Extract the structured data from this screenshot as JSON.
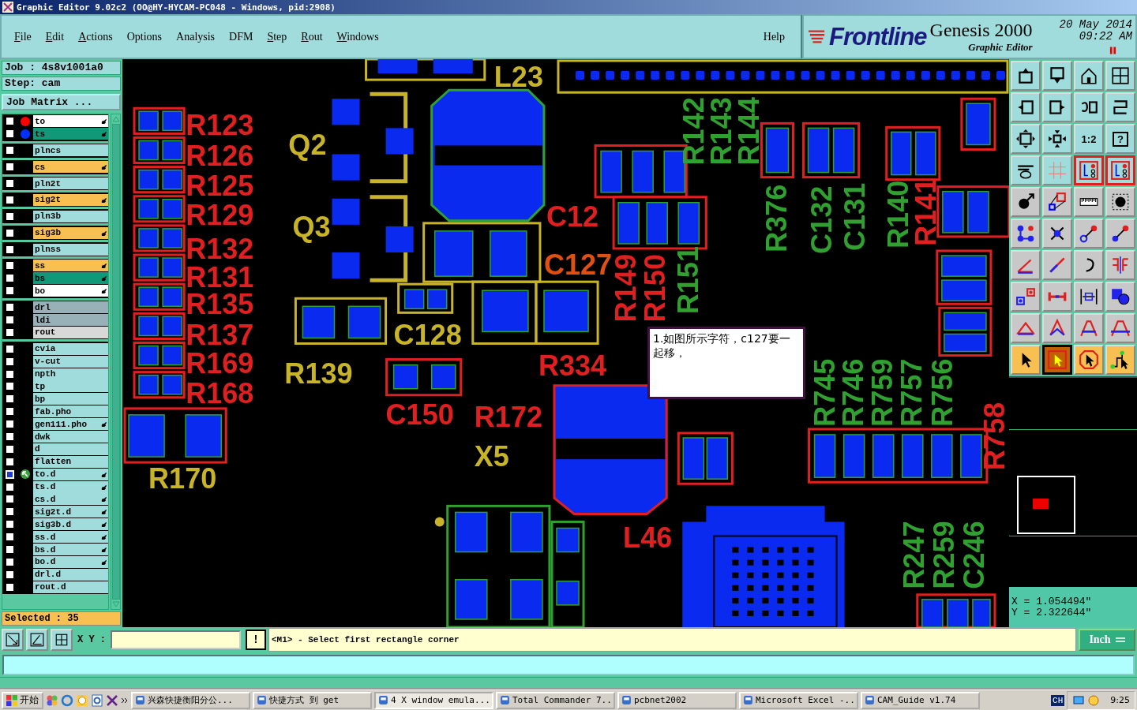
{
  "window": {
    "title": "Graphic Editor 9.02c2 (OO@HY-HYCAM-PC048 - Windows, pid:2908)"
  },
  "menu": [
    {
      "label": "File",
      "mnemonic": true
    },
    {
      "label": "Edit",
      "mnemonic": true
    },
    {
      "label": "Actions",
      "mnemonic": true
    },
    {
      "label": "Options",
      "mnemonic": false
    },
    {
      "label": "Analysis",
      "mnemonic": false
    },
    {
      "label": "DFM",
      "mnemonic": false
    },
    {
      "label": "Step",
      "mnemonic": true
    },
    {
      "label": "Rout",
      "mnemonic": true
    },
    {
      "label": "Windows",
      "mnemonic": true
    }
  ],
  "help": "Help",
  "logo": {
    "brand": "Frontline",
    "product": "Genesis 2000",
    "subtitle": "Graphic Editor",
    "date": "20 May 2014",
    "time": "09:22 AM"
  },
  "job": {
    "job": "Job : 4s8v1001a0",
    "step": "Step: cam",
    "matrix_button": "Job Matrix ..."
  },
  "layer_groups": [
    [
      {
        "name": "to",
        "kind": "white",
        "color": "#ff0000",
        "affected": true,
        "selected": false,
        "work": false
      },
      {
        "name": "ts",
        "kind": "teal",
        "color": "#0030ff",
        "affected": true,
        "selected": false,
        "work": false
      }
    ],
    [
      {
        "name": "plncs",
        "kind": "plain",
        "affected": false,
        "selected": false,
        "work": false
      }
    ],
    [
      {
        "name": "cs",
        "kind": "orange",
        "affected": true,
        "selected": false,
        "work": false
      }
    ],
    [
      {
        "name": "pln2t",
        "kind": "plain",
        "affected": false,
        "selected": false,
        "work": false
      }
    ],
    [
      {
        "name": "sig2t",
        "kind": "orange",
        "affected": true,
        "selected": false,
        "work": false
      }
    ],
    [
      {
        "name": "pln3b",
        "kind": "plain",
        "affected": false,
        "selected": false,
        "work": false
      }
    ],
    [
      {
        "name": "sig3b",
        "kind": "orange",
        "affected": true,
        "selected": false,
        "work": false
      }
    ],
    [
      {
        "name": "plnss",
        "kind": "plain",
        "affected": false,
        "selected": false,
        "work": false
      }
    ],
    [
      {
        "name": "ss",
        "kind": "orange",
        "affected": true,
        "selected": false,
        "work": false
      },
      {
        "name": "bs",
        "kind": "teal",
        "affected": true,
        "selected": false,
        "work": false
      },
      {
        "name": "bo",
        "kind": "white",
        "affected": true,
        "selected": false,
        "work": false
      }
    ],
    [
      {
        "name": "drl",
        "kind": "grey",
        "affected": false,
        "selected": false,
        "work": false
      },
      {
        "name": "ldi",
        "kind": "grey",
        "affected": false,
        "selected": false,
        "work": false
      },
      {
        "name": "rout",
        "kind": "light",
        "affected": false,
        "selected": false,
        "work": false
      }
    ],
    [
      {
        "name": "cvia",
        "kind": "plain",
        "affected": false,
        "selected": false,
        "work": false
      },
      {
        "name": "v-cut",
        "kind": "plain",
        "affected": false,
        "selected": false,
        "work": false
      },
      {
        "name": "npth",
        "kind": "plain",
        "affected": false,
        "selected": false,
        "work": false
      },
      {
        "name": "tp",
        "kind": "plain",
        "affected": false,
        "selected": false,
        "work": false
      },
      {
        "name": "bp",
        "kind": "plain",
        "affected": false,
        "selected": false,
        "work": false
      },
      {
        "name": "fab.pho",
        "kind": "plain",
        "affected": false,
        "selected": false,
        "work": false
      },
      {
        "name": "gen111.pho",
        "kind": "plain",
        "affected": true,
        "selected": false,
        "work": false
      },
      {
        "name": "dwk",
        "kind": "plain",
        "affected": false,
        "selected": false,
        "work": false
      },
      {
        "name": "d",
        "kind": "plain",
        "affected": false,
        "selected": false,
        "work": false
      },
      {
        "name": "flatten",
        "kind": "plain",
        "affected": false,
        "selected": false,
        "work": false
      },
      {
        "name": "to.d",
        "kind": "plain",
        "affected": true,
        "selected": true,
        "work": true
      },
      {
        "name": "ts.d",
        "kind": "plain",
        "affected": true,
        "selected": false,
        "work": false
      },
      {
        "name": "cs.d",
        "kind": "plain",
        "affected": true,
        "selected": false,
        "work": false
      },
      {
        "name": "sig2t.d",
        "kind": "plain",
        "affected": true,
        "selected": false,
        "work": false
      },
      {
        "name": "sig3b.d",
        "kind": "plain",
        "affected": true,
        "selected": false,
        "work": false
      },
      {
        "name": "ss.d",
        "kind": "plain",
        "affected": true,
        "selected": false,
        "work": false
      },
      {
        "name": "bs.d",
        "kind": "plain",
        "affected": true,
        "selected": false,
        "work": false
      },
      {
        "name": "bo.d",
        "kind": "plain",
        "affected": true,
        "selected": false,
        "work": false
      },
      {
        "name": "drl.d",
        "kind": "plain",
        "affected": false,
        "selected": false,
        "work": false
      },
      {
        "name": "rout.d",
        "kind": "plain",
        "affected": false,
        "selected": false,
        "work": false
      }
    ]
  ],
  "selected_count": "Selected : 35",
  "canvas_labels": [
    {
      "text": "R123",
      "color": "#e02020",
      "vertical": false
    },
    {
      "text": "R126",
      "color": "#e02020",
      "vertical": false
    },
    {
      "text": "R125",
      "color": "#e02020",
      "vertical": false
    },
    {
      "text": "R129",
      "color": "#e02020",
      "vertical": false
    },
    {
      "text": "R132",
      "color": "#e02020",
      "vertical": false
    },
    {
      "text": "R131",
      "color": "#e02020",
      "vertical": false
    },
    {
      "text": "R135",
      "color": "#e02020",
      "vertical": false
    },
    {
      "text": "R137",
      "color": "#e02020",
      "vertical": false
    },
    {
      "text": "R169",
      "color": "#e02020",
      "vertical": false
    },
    {
      "text": "R168",
      "color": "#e02020",
      "vertical": false
    },
    {
      "text": "Q2",
      "color": "#c8b428",
      "vertical": false
    },
    {
      "text": "Q3",
      "color": "#c8b428",
      "vertical": false
    },
    {
      "text": "L23",
      "color": "#c8b428",
      "vertical": false
    },
    {
      "text": "C128",
      "color": "#c8b428",
      "vertical": false
    },
    {
      "text": "R139",
      "color": "#c8b428",
      "vertical": false
    },
    {
      "text": "R170",
      "color": "#c8b428",
      "vertical": false
    },
    {
      "text": "X5",
      "color": "#c8b428",
      "vertical": false
    },
    {
      "text": "C12",
      "color": "#e02020",
      "vertical": false
    },
    {
      "text": "C127",
      "color": "#e05010",
      "vertical": false
    },
    {
      "text": "C150",
      "color": "#e02020",
      "vertical": false
    },
    {
      "text": "R172",
      "color": "#e02020",
      "vertical": false
    },
    {
      "text": "R334",
      "color": "#e02020",
      "vertical": false
    },
    {
      "text": "L46",
      "color": "#e02020",
      "vertical": false
    },
    {
      "text": "R142",
      "color": "#30a030",
      "vertical": true
    },
    {
      "text": "R143",
      "color": "#30a030",
      "vertical": true
    },
    {
      "text": "R144",
      "color": "#30a030",
      "vertical": true
    },
    {
      "text": "R376",
      "color": "#30a030",
      "vertical": true
    },
    {
      "text": "C132",
      "color": "#30a030",
      "vertical": true
    },
    {
      "text": "C131",
      "color": "#30a030",
      "vertical": true
    },
    {
      "text": "R140",
      "color": "#30a030",
      "vertical": true
    },
    {
      "text": "R141",
      "color": "#e02020",
      "vertical": true
    },
    {
      "text": "R149",
      "color": "#e02020",
      "vertical": true
    },
    {
      "text": "R150",
      "color": "#e02020",
      "vertical": true
    },
    {
      "text": "R151",
      "color": "#30a030",
      "vertical": true
    },
    {
      "text": "R745",
      "color": "#30a030",
      "vertical": true
    },
    {
      "text": "R746",
      "color": "#30a030",
      "vertical": true
    },
    {
      "text": "R759",
      "color": "#30a030",
      "vertical": true
    },
    {
      "text": "R757",
      "color": "#30a030",
      "vertical": true
    },
    {
      "text": "R756",
      "color": "#30a030",
      "vertical": true
    },
    {
      "text": "R758",
      "color": "#e02020",
      "vertical": true
    },
    {
      "text": "R247",
      "color": "#30a030",
      "vertical": true
    },
    {
      "text": "R259",
      "color": "#30a030",
      "vertical": true
    },
    {
      "text": "C246",
      "color": "#30a030",
      "vertical": true
    }
  ],
  "note": "1.如图所示字符，c127要一起移，",
  "toolbox": {
    "labels": [
      "1:2",
      "?"
    ],
    "buttons": [
      {
        "selected": false
      },
      {
        "selected": false
      },
      {
        "selected": false
      },
      {
        "selected": false
      },
      {
        "selected": false
      },
      {
        "selected": false
      },
      {
        "selected": false
      },
      {
        "selected": false
      },
      {
        "selected": false
      },
      {
        "selected": false
      },
      {
        "selected": false
      },
      {
        "selected": false
      },
      {
        "selected": false
      },
      {
        "selected": false
      },
      {
        "selected": false
      },
      {
        "selected": false
      },
      {
        "selected": false
      },
      {
        "selected": false
      },
      {
        "selected": false
      },
      {
        "selected": false
      },
      {
        "selected": false
      },
      {
        "selected": false
      },
      {
        "selected": false
      },
      {
        "selected": false
      },
      {
        "selected": false
      },
      {
        "selected": false
      },
      {
        "selected": false
      },
      {
        "selected": false
      },
      {
        "selected": false
      },
      {
        "selected": false
      },
      {
        "selected": false
      },
      {
        "selected": false
      },
      {
        "selected": false
      },
      {
        "selected": false
      },
      {
        "selected": false
      },
      {
        "selected": false
      },
      {
        "selected": false
      },
      {
        "selected": true
      },
      {
        "selected": false
      },
      {
        "selected": false
      }
    ]
  },
  "coords": {
    "x": "X = 1.054494\"",
    "y": "Y = 2.322644\""
  },
  "command": {
    "xy_label": "X Y :",
    "bang": "!",
    "message": "<M1> - Select first rectangle corner",
    "units": "Inch"
  },
  "taskbar": {
    "start": "开始",
    "tasks": [
      {
        "label": "兴森快捷衡阳分公...",
        "selected": false
      },
      {
        "label": "快捷方式 到 get",
        "selected": false
      },
      {
        "label": "4 X window emula...",
        "selected": true
      },
      {
        "label": "Total Commander 7...",
        "selected": false
      },
      {
        "label": "pcbnet2002",
        "selected": false
      },
      {
        "label": "Microsoft Excel -...",
        "selected": false
      },
      {
        "label": "CAM_Guide v1.74",
        "selected": false
      }
    ],
    "language": "CH",
    "time": "9:25"
  }
}
